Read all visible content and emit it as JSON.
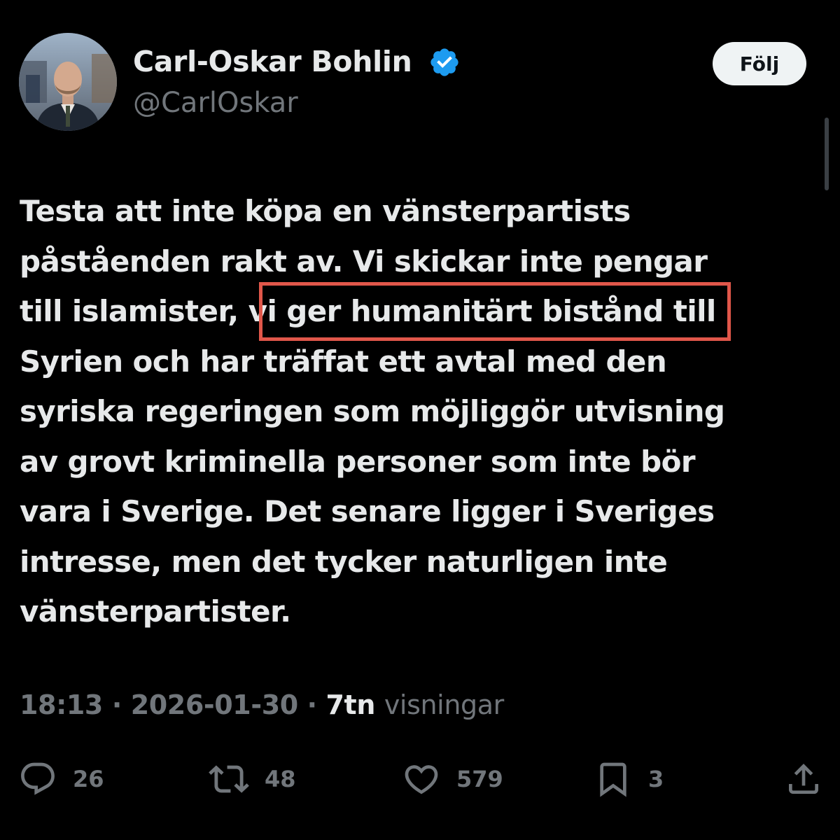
{
  "tweet": {
    "author": {
      "display_name": "Carl-Oskar Bohlin",
      "handle": "@CarlOskar",
      "verified": true,
      "verified_color": "#1d9bf0"
    },
    "follow_label": "Följ",
    "text_lines": [
      "Testa att inte köpa en vänsterpartists",
      "påståenden rakt av. Vi skickar inte pengar",
      "till islamister, vi ger humanitärt bistånd till",
      "Syrien och har träffat ett avtal med den",
      "syriska regeringen som möjliggör utvisning",
      "av grovt kriminella personer som inte bör",
      "vara i Sverige. Det senare ligger i Sveriges",
      "intresse, men det tycker naturligen inte",
      "vänsterpartister."
    ],
    "highlighted_phrase": "vi ger humanitärt bistånd",
    "highlight_color": "#e0574a",
    "time": "18:13",
    "date": "2026-01-30",
    "separator": "·",
    "views_count": "7tn",
    "views_label": "visningar"
  },
  "actions": {
    "replies": {
      "icon": "reply-icon",
      "count": "26"
    },
    "reposts": {
      "icon": "repost-icon",
      "count": "48"
    },
    "likes": {
      "icon": "heart-icon",
      "count": "579"
    },
    "bookmarks": {
      "icon": "bookmark-icon",
      "count": "3"
    },
    "share": {
      "icon": "share-icon"
    }
  },
  "colors": {
    "background": "#000000",
    "text_primary": "#e7e9ea",
    "text_secondary": "#71767b"
  }
}
